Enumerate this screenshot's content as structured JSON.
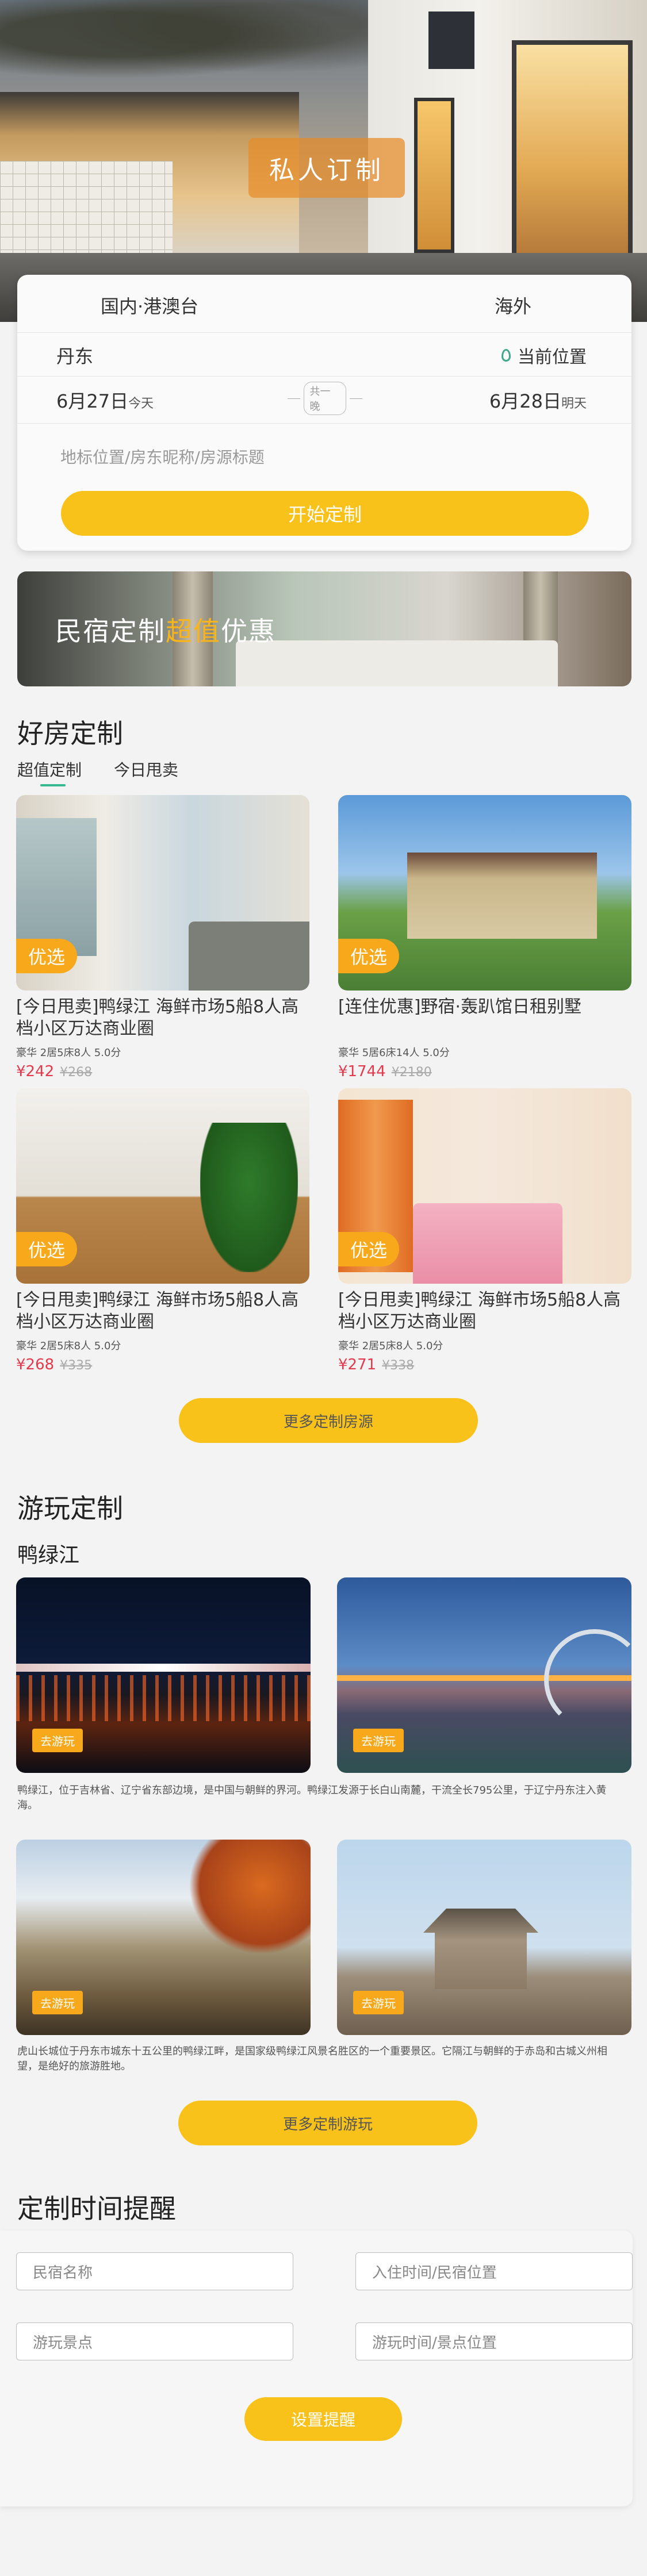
{
  "hero": {
    "title": "私人订制"
  },
  "booking": {
    "tab_domestic": "国内·港澳台",
    "tab_overseas": "海外",
    "city": "丹东",
    "location_label": "当前位置",
    "checkin_date": "6月27日",
    "checkin_day": "今天",
    "nights": "共一晚",
    "checkout_date": "6月28日",
    "checkout_day": "明天",
    "search_placeholder": "地标位置/房东昵称/房源标题",
    "start_button": "开始定制"
  },
  "banner": {
    "text_a": "民宿定制",
    "text_b": "超值",
    "text_c": "优惠"
  },
  "rooms": {
    "heading": "好房定制",
    "tab_value": "超值定制",
    "tab_today": "今日甩卖",
    "badge": "优选",
    "items": [
      {
        "title": "[今日甩卖]鸭绿江  海鲜市场5船8人高档小区万达商业圈",
        "meta": "豪华 2居5床8人 5.0分",
        "price": "¥242",
        "old": "¥268"
      },
      {
        "title": "[连住优惠]野宿·轰趴馆日租别墅",
        "meta": "豪华 5居6床14人 5.0分",
        "price": "¥1744",
        "old": "¥2180"
      },
      {
        "title": "[今日甩卖]鸭绿江  海鲜市场5船8人高档小区万达商业圈",
        "meta": "豪华 2居5床8人 5.0分",
        "price": "¥268",
        "old": "¥335"
      },
      {
        "title": "[今日甩卖]鸭绿江  海鲜市场5船8人高档小区万达商业圈",
        "meta": "豪华 2居5床8人 5.0分",
        "price": "¥271",
        "old": "¥338"
      }
    ],
    "more_button": "更多定制房源"
  },
  "play": {
    "heading": "游玩定制",
    "city": "鸭绿江",
    "tag": "去游玩",
    "desc1": "鸭绿江，位于吉林省、辽宁省东部边境，是中国与朝鲜的界河。鸭绿江发源于长白山南麓，干流全长795公里，于辽宁丹东注入黄海。",
    "desc2": "虎山长城位于丹东市城东十五公里的鸭绿江畔，是国家级鸭绿江风景名胜区的一个重要景区。它隔江与朝鲜的于赤岛和古城义州相望，是绝好的旅游胜地。",
    "more_button": "更多定制游玩"
  },
  "reminder": {
    "heading": "定制时间提醒",
    "field_homestay": "民宿名称",
    "field_checkin": "入住时间/民宿位置",
    "field_spot": "游玩景点",
    "field_time": "游玩时间/景点位置",
    "button": "设置提醒"
  }
}
